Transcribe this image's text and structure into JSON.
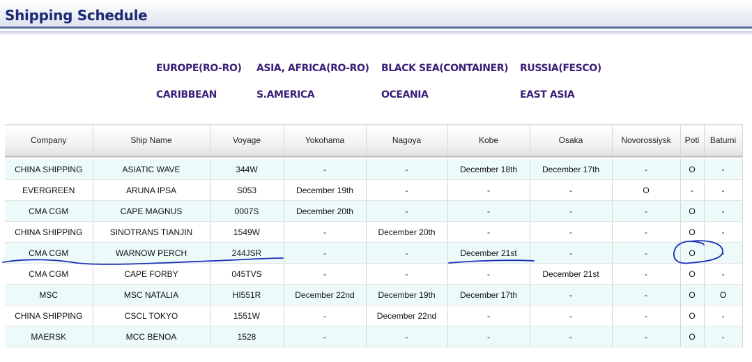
{
  "page": {
    "title": "Shipping Schedule"
  },
  "regions": [
    {
      "label": "EUROPE(RO-RO)"
    },
    {
      "label": "ASIA, AFRICA(RO-RO)"
    },
    {
      "label": "BLACK SEA(CONTAINER)"
    },
    {
      "label": "RUSSIA(FESCO)"
    },
    {
      "label": "CARIBBEAN"
    },
    {
      "label": "S.AMERICA"
    },
    {
      "label": "OCEANIA"
    },
    {
      "label": "EAST ASIA"
    }
  ],
  "table": {
    "headers": [
      "Company",
      "Ship Name",
      "Voyage",
      "Yokohama",
      "Nagoya",
      "Kobe",
      "Osaka",
      "Novorossiysk",
      "Poti",
      "Batumi"
    ],
    "rows": [
      [
        "CHINA SHIPPING",
        "ASIATIC WAVE",
        "344W",
        "-",
        "-",
        "December 18th",
        "December 17th",
        "-",
        "O",
        "-"
      ],
      [
        "EVERGREEN",
        "ARUNA IPSA",
        "S053",
        "December 19th",
        "-",
        "-",
        "-",
        "O",
        "-",
        "-"
      ],
      [
        "CMA CGM",
        "CAPE MAGNUS",
        "0007S",
        "December 20th",
        "-",
        "-",
        "-",
        "-",
        "O",
        "-"
      ],
      [
        "CHINA SHIPPING",
        "SINOTRANS TIANJIN",
        "1549W",
        "-",
        "December 20th",
        "-",
        "-",
        "-",
        "O",
        "-"
      ],
      [
        "CMA CGM",
        "WARNOW PERCH",
        "244JSR",
        "-",
        "-",
        "December 21st",
        "-",
        "-",
        "O",
        "-"
      ],
      [
        "CMA CGM",
        "CAPE FORBY",
        "045TVS",
        "-",
        "-",
        "-",
        "December 21st",
        "-",
        "O",
        "-"
      ],
      [
        "MSC",
        "MSC NATALIA",
        "HI551R",
        "December 22nd",
        "December 19th",
        "December 17th",
        "-",
        "-",
        "O",
        "O"
      ],
      [
        "CHINA SHIPPING",
        "CSCL TOKYO",
        "1551W",
        "-",
        "December 22nd",
        "-",
        "-",
        "-",
        "O",
        "-"
      ],
      [
        "MAERSK",
        "MCC BENOA",
        "1528",
        "-",
        "-",
        "-",
        "-",
        "-",
        "O",
        "-"
      ]
    ]
  },
  "colors": {
    "title_text": "#1c2a73",
    "region_link": "#3b1f78",
    "row_tint": "#edfafa",
    "annotation_ink": "#1a2fb8"
  }
}
